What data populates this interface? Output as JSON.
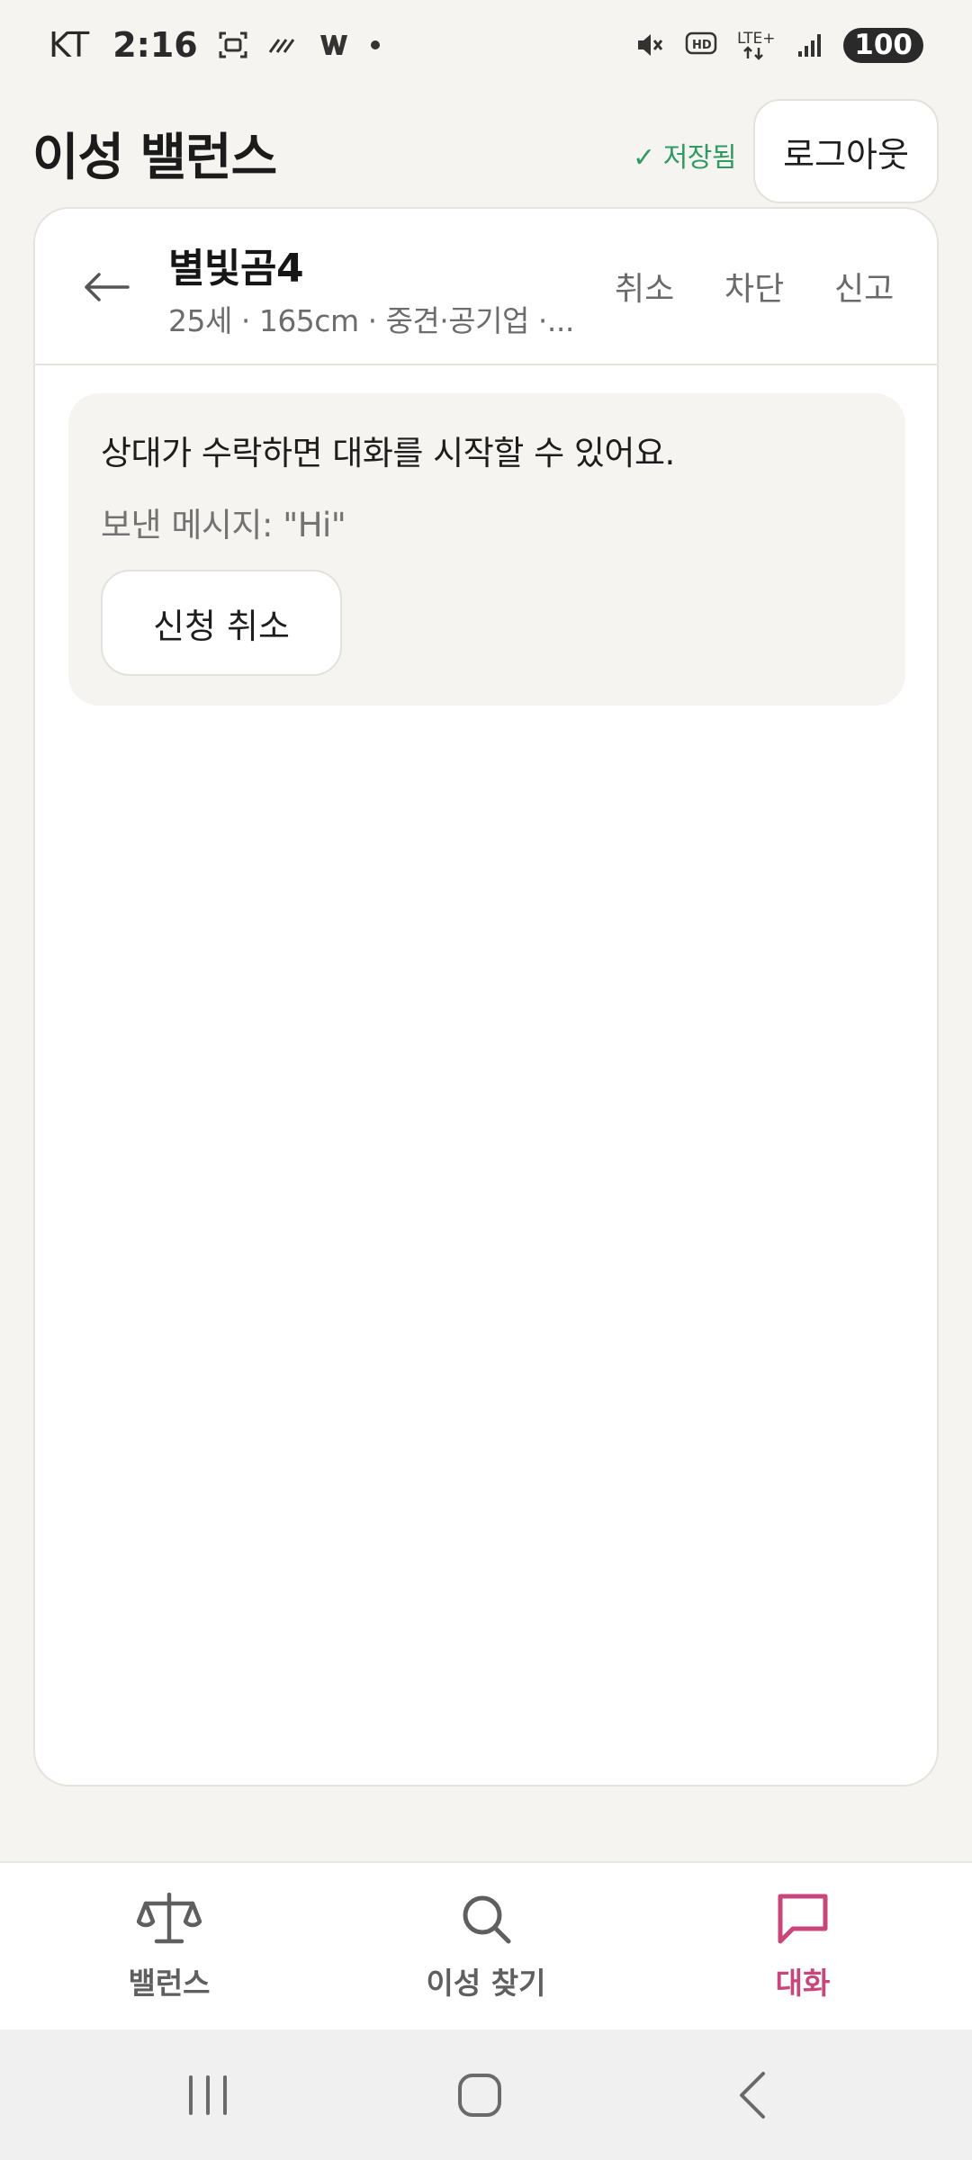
{
  "status_bar": {
    "carrier": "KT",
    "time": "2:16",
    "battery": "100",
    "icons": [
      "screenshot-icon",
      "data-saver-icon",
      "w-app-icon",
      "dot-icon",
      "mute-icon",
      "hd-voice-icon",
      "lte-plus-icon",
      "signal-icon",
      "battery-icon"
    ]
  },
  "header": {
    "title": "이성 밸런스",
    "saved_label": "✓ 저장됨",
    "logout_label": "로그아웃"
  },
  "chat": {
    "partner_name": "별빛곰4",
    "partner_meta": "25세 · 165cm · 중견·공기업 ·...",
    "actions": {
      "cancel": "취소",
      "block": "차단",
      "report": "신고"
    },
    "request": {
      "info": "상대가 수락하면 대화를 시작할 수 있어요.",
      "sent_message": "보낸 메시지: \"Hi\"",
      "cancel_button": "신청 취소"
    }
  },
  "bottom_nav": {
    "items": [
      {
        "label": "밸런스",
        "icon": "scale-icon"
      },
      {
        "label": "이성 찾기",
        "icon": "search-icon"
      },
      {
        "label": "대화",
        "icon": "chat-bubble-icon"
      }
    ],
    "active_color": "#c8467a",
    "inactive_color": "#5f5f5f"
  },
  "colors": {
    "background": "#f5f4f0",
    "saved_green": "#2f9a62",
    "accent_pink": "#c8467a"
  }
}
